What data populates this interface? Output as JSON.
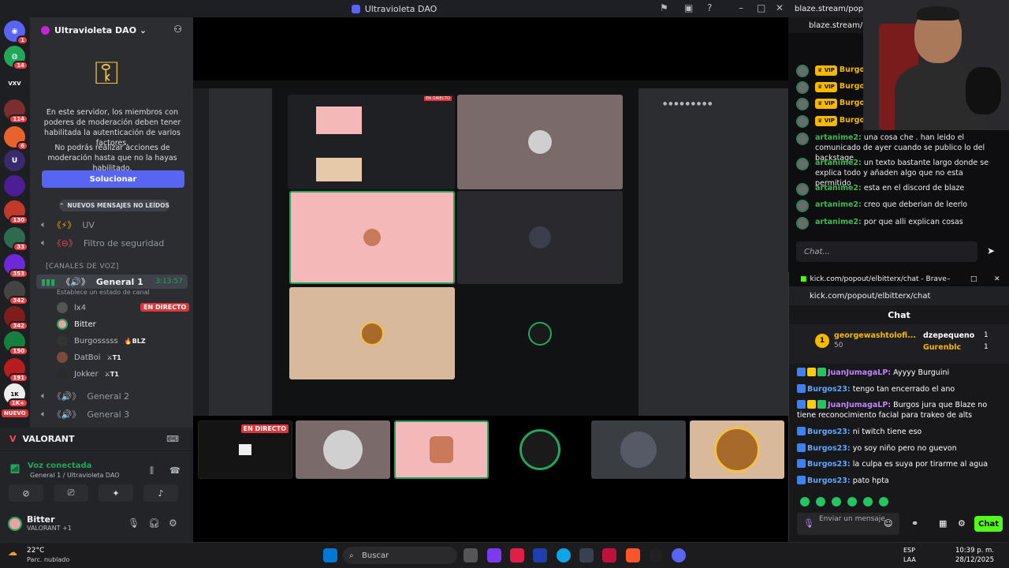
{
  "window": {
    "title": "Ultravioleta DAO"
  },
  "rail": {
    "badges": [
      "1",
      "14",
      "114",
      "6",
      "130",
      "33",
      "353",
      "342",
      "150",
      "191",
      "1K+"
    ],
    "new_label": "NUEVO"
  },
  "server": {
    "name": "Ultravioleta DAO ⌄"
  },
  "mod_notice": {
    "text1": "En este servidor, los miembros con poderes de moderación deben tener habilitada la autenticación de varios factores.",
    "text2": "No podrás realizar acciones de moderación hasta que no la hayas habilitado.",
    "button": "Solucionar"
  },
  "channels": {
    "new_messages": "NUEVOS MENSAJES NO LEÍDOS",
    "uv": "UV",
    "filter": "Filtro de seguridad",
    "voice_category": "[CANALES DE VOZ]",
    "general1": "General 1",
    "general1_time": "3:13:57",
    "general1_status": "Establece un estado de canal",
    "general2": "General 2",
    "general3": "General 3"
  },
  "voice_users": [
    {
      "name": "lx4",
      "live": "EN DIRECTO"
    },
    {
      "name": "Bitter"
    },
    {
      "name": "Burgosssss",
      "tag": "BLZ"
    },
    {
      "name": "DatBoi",
      "tag": "T1"
    },
    {
      "name": "Jokker",
      "tag": "T1"
    }
  ],
  "bottom": {
    "game": "VALORANT",
    "voice_connected": "Voz conectada",
    "voice_sub": "General 1 / Ultravioleta DAO",
    "user": "Bitter",
    "user_status": "VALORANT +1"
  },
  "stage": {
    "live_badge": "EN DIRECTO"
  },
  "blaze": {
    "tab": "blaze.stream/popo",
    "url": "blaze.stream/po",
    "vip_name": "Burgo",
    "messages": [
      {
        "user": "artanime2:",
        "text": "una cosa che . han leido el comunicado de ayer cuando se publico lo del backstage"
      },
      {
        "user": "artanime2:",
        "text": "un texto bastante largo donde se explica todo y añaden algo que no esta permitido"
      },
      {
        "user": "artanime2:",
        "text": "esta en el discord de blaze"
      },
      {
        "user": "artanime2:",
        "text": "creo que deberian de leerlo"
      },
      {
        "user": "artanime2:",
        "text": "por que alli explican cosas"
      }
    ],
    "input_placeholder": "Chat..."
  },
  "kick": {
    "tab": "kick.com/popout/elbitterx/chat - Brave",
    "url": "kick.com/popout/elbitterx/chat",
    "title": "Chat",
    "top_gifters": [
      {
        "name": "georgewashtolofi...",
        "count": "50"
      },
      {
        "name": "dzepequeno",
        "count": "1"
      },
      {
        "name": "Gurenblc",
        "count": "1"
      }
    ],
    "messages": [
      {
        "user": "JuanJumagaLP:",
        "text": "Ayyyy Burguini"
      },
      {
        "user": "Burgos23:",
        "text": "tengo tan encerrado el ano"
      },
      {
        "user": "JuanJumagaLP:",
        "text": "Burgos jura que Blaze no tiene reconocimiento facial para trakeo de alts"
      },
      {
        "user": "Burgos23:",
        "text": "ni twitch tiene eso"
      },
      {
        "user": "Burgos23:",
        "text": "yo soy niño pero no guevon"
      },
      {
        "user": "Burgos23:",
        "text": "la culpa es suya por tirarme al agua"
      },
      {
        "user": "Burgos23:",
        "text": "pato hpta"
      }
    ],
    "input_placeholder": "Enviar un mensaje",
    "send_label": "Chat"
  },
  "taskbar": {
    "weather_temp": "22°C",
    "weather_desc": "Parc. nublado",
    "search": "Buscar",
    "lang1": "ESP",
    "lang2": "LAA",
    "time": "10:39 p. m.",
    "date": "28/12/2025"
  }
}
